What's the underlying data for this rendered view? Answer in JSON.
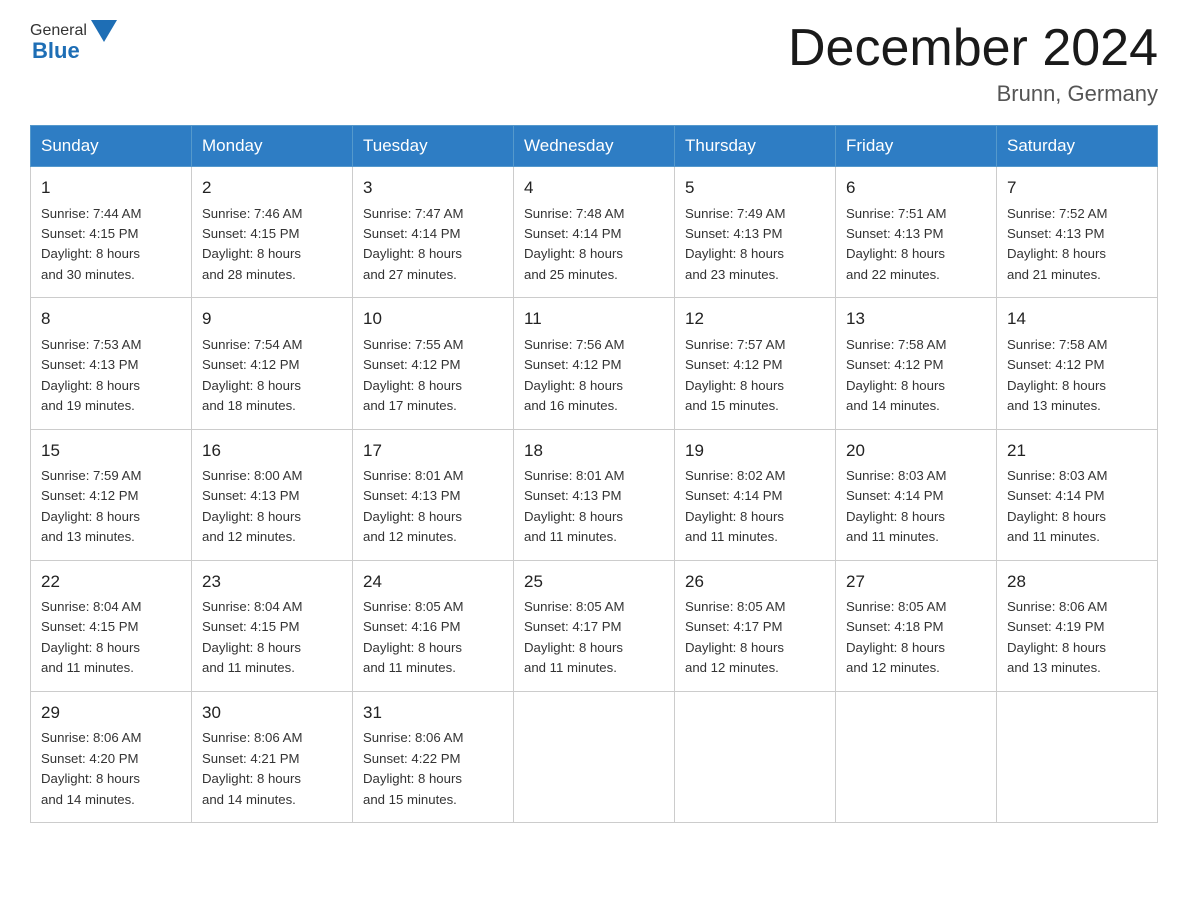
{
  "header": {
    "logo_general": "General",
    "logo_blue": "Blue",
    "month_title": "December 2024",
    "location": "Brunn, Germany"
  },
  "weekdays": [
    "Sunday",
    "Monday",
    "Tuesday",
    "Wednesday",
    "Thursday",
    "Friday",
    "Saturday"
  ],
  "weeks": [
    [
      {
        "day": "1",
        "sunrise": "7:44 AM",
        "sunset": "4:15 PM",
        "daylight": "8 hours and 30 minutes."
      },
      {
        "day": "2",
        "sunrise": "7:46 AM",
        "sunset": "4:15 PM",
        "daylight": "8 hours and 28 minutes."
      },
      {
        "day": "3",
        "sunrise": "7:47 AM",
        "sunset": "4:14 PM",
        "daylight": "8 hours and 27 minutes."
      },
      {
        "day": "4",
        "sunrise": "7:48 AM",
        "sunset": "4:14 PM",
        "daylight": "8 hours and 25 minutes."
      },
      {
        "day": "5",
        "sunrise": "7:49 AM",
        "sunset": "4:13 PM",
        "daylight": "8 hours and 23 minutes."
      },
      {
        "day": "6",
        "sunrise": "7:51 AM",
        "sunset": "4:13 PM",
        "daylight": "8 hours and 22 minutes."
      },
      {
        "day": "7",
        "sunrise": "7:52 AM",
        "sunset": "4:13 PM",
        "daylight": "8 hours and 21 minutes."
      }
    ],
    [
      {
        "day": "8",
        "sunrise": "7:53 AM",
        "sunset": "4:13 PM",
        "daylight": "8 hours and 19 minutes."
      },
      {
        "day": "9",
        "sunrise": "7:54 AM",
        "sunset": "4:12 PM",
        "daylight": "8 hours and 18 minutes."
      },
      {
        "day": "10",
        "sunrise": "7:55 AM",
        "sunset": "4:12 PM",
        "daylight": "8 hours and 17 minutes."
      },
      {
        "day": "11",
        "sunrise": "7:56 AM",
        "sunset": "4:12 PM",
        "daylight": "8 hours and 16 minutes."
      },
      {
        "day": "12",
        "sunrise": "7:57 AM",
        "sunset": "4:12 PM",
        "daylight": "8 hours and 15 minutes."
      },
      {
        "day": "13",
        "sunrise": "7:58 AM",
        "sunset": "4:12 PM",
        "daylight": "8 hours and 14 minutes."
      },
      {
        "day": "14",
        "sunrise": "7:58 AM",
        "sunset": "4:12 PM",
        "daylight": "8 hours and 13 minutes."
      }
    ],
    [
      {
        "day": "15",
        "sunrise": "7:59 AM",
        "sunset": "4:12 PM",
        "daylight": "8 hours and 13 minutes."
      },
      {
        "day": "16",
        "sunrise": "8:00 AM",
        "sunset": "4:13 PM",
        "daylight": "8 hours and 12 minutes."
      },
      {
        "day": "17",
        "sunrise": "8:01 AM",
        "sunset": "4:13 PM",
        "daylight": "8 hours and 12 minutes."
      },
      {
        "day": "18",
        "sunrise": "8:01 AM",
        "sunset": "4:13 PM",
        "daylight": "8 hours and 11 minutes."
      },
      {
        "day": "19",
        "sunrise": "8:02 AM",
        "sunset": "4:14 PM",
        "daylight": "8 hours and 11 minutes."
      },
      {
        "day": "20",
        "sunrise": "8:03 AM",
        "sunset": "4:14 PM",
        "daylight": "8 hours and 11 minutes."
      },
      {
        "day": "21",
        "sunrise": "8:03 AM",
        "sunset": "4:14 PM",
        "daylight": "8 hours and 11 minutes."
      }
    ],
    [
      {
        "day": "22",
        "sunrise": "8:04 AM",
        "sunset": "4:15 PM",
        "daylight": "8 hours and 11 minutes."
      },
      {
        "day": "23",
        "sunrise": "8:04 AM",
        "sunset": "4:15 PM",
        "daylight": "8 hours and 11 minutes."
      },
      {
        "day": "24",
        "sunrise": "8:05 AM",
        "sunset": "4:16 PM",
        "daylight": "8 hours and 11 minutes."
      },
      {
        "day": "25",
        "sunrise": "8:05 AM",
        "sunset": "4:17 PM",
        "daylight": "8 hours and 11 minutes."
      },
      {
        "day": "26",
        "sunrise": "8:05 AM",
        "sunset": "4:17 PM",
        "daylight": "8 hours and 12 minutes."
      },
      {
        "day": "27",
        "sunrise": "8:05 AM",
        "sunset": "4:18 PM",
        "daylight": "8 hours and 12 minutes."
      },
      {
        "day": "28",
        "sunrise": "8:06 AM",
        "sunset": "4:19 PM",
        "daylight": "8 hours and 13 minutes."
      }
    ],
    [
      {
        "day": "29",
        "sunrise": "8:06 AM",
        "sunset": "4:20 PM",
        "daylight": "8 hours and 14 minutes."
      },
      {
        "day": "30",
        "sunrise": "8:06 AM",
        "sunset": "4:21 PM",
        "daylight": "8 hours and 14 minutes."
      },
      {
        "day": "31",
        "sunrise": "8:06 AM",
        "sunset": "4:22 PM",
        "daylight": "8 hours and 15 minutes."
      },
      null,
      null,
      null,
      null
    ]
  ],
  "labels": {
    "sunrise": "Sunrise:",
    "sunset": "Sunset:",
    "daylight": "Daylight:"
  }
}
